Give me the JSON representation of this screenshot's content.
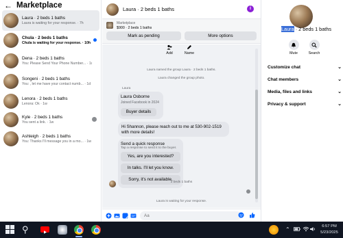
{
  "left_panel": {
    "title": "Marketplace",
    "conversations": [
      {
        "name": "Laura · 2 beds 1 baths",
        "preview": "Laura is waiting for your response. · 7h",
        "unread": false,
        "active": true
      },
      {
        "name": "Chula · 2 beds 1 baths",
        "preview": "Chula is waiting for your response. · 10h",
        "unread": true,
        "active": false
      },
      {
        "name": "Dena · 2 beds 1 baths",
        "preview": "You: Please Send Your Phone Number... · 1d",
        "unread": false,
        "active": false
      },
      {
        "name": "Songeni · 2 beds 1 baths",
        "preview": "You: , let me have your contact numb... · 1d",
        "unread": false,
        "active": false
      },
      {
        "name": "Lenora · 2 beds 1 baths",
        "preview": "Lenora: Ok · 1w",
        "unread": false,
        "active": false
      },
      {
        "name": "Kyle · 2 beds 1 baths",
        "preview": "You sent a link. · 1w",
        "unread": false,
        "active": false
      },
      {
        "name": "Ashleigh · 2 beds 1 baths",
        "preview": "You: Thanks I'll message you in a mo... · 1w",
        "unread": false,
        "active": false
      }
    ]
  },
  "chat": {
    "header_title": "Laura · 2 beds 1 baths",
    "marketplace_label": "Marketplace",
    "listing_price": "$900 · 2 beds 1 baths",
    "mark_pending_label": "Mark as pending",
    "more_options_label": "More options",
    "add_label": "Add",
    "name_label": "Name",
    "system_messages": [
      "Laura named the group Laura · 2 beds 1 baths.",
      "Laura changed the group photo."
    ],
    "sender_name": "Laura",
    "profile_card": {
      "name": "Laura Osborne",
      "subtitle": "Joined Facebook in 2024",
      "button": "Buyer details"
    },
    "message": "Hi Shannon, please reach out to me at 530-902-1519 with more details!",
    "quick_response": {
      "title": "Send a quick response",
      "subtitle": "Tap a response to send it to the buyer.",
      "options": [
        "Yes, are you interested?",
        "In talks. I'll let you know.",
        "Sorry, it's not available."
      ]
    },
    "time_stamp": "2 beds 1 baths",
    "waiting_status": "Laura is waiting for your response.",
    "composer_placeholder": "Aa"
  },
  "right_panel": {
    "title_highlight": "Laura",
    "title_rest": " · 2 beds 1 baths",
    "actions": [
      {
        "label": "Mute",
        "icon": "bell-icon"
      },
      {
        "label": "Search",
        "icon": "search-icon"
      }
    ],
    "sections": [
      "Customize chat",
      "Chat members",
      "Media, files and links",
      "Privacy & support"
    ]
  },
  "taskbar": {
    "time": "6:57 PM",
    "date": "5/23/2025"
  },
  "colors": {
    "accent": "#0866ff",
    "info_purple": "#8b1fd6",
    "selection": "#3b6fd8",
    "taskbar": "#101622"
  }
}
